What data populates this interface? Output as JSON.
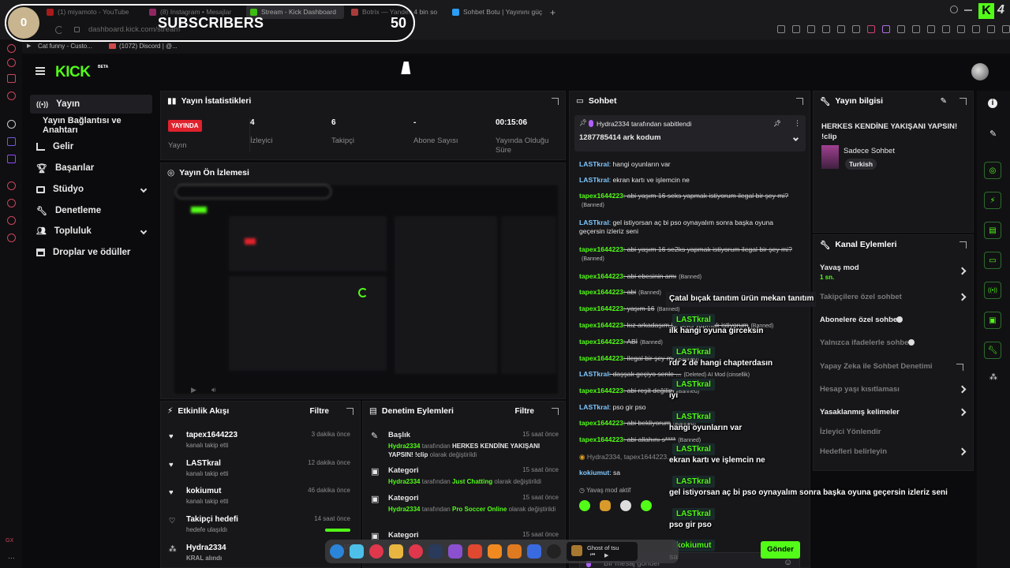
{
  "browser": {
    "tabs": [
      {
        "label": "(1) miyamoto - YouTube",
        "color": "#e02424"
      },
      {
        "label": "(8) Instagram • Mesajlar",
        "color": "#c13584"
      },
      {
        "label": "Stream - Kick Dashboard",
        "color": "#53fc18"
      },
      {
        "label": "Botrix — Yandex 4 bin so",
        "color": "#e05050"
      },
      {
        "label": "Sohbet Botu | Yayınını güç",
        "color": "#2a9df4"
      }
    ],
    "url": "dashboard.kick.com/stream",
    "bookmarks": [
      "Cat funny - Custo...",
      "(1072) Discord | @..."
    ],
    "brand_logo_text": "K",
    "brand_badge": "4"
  },
  "overlay": {
    "subscriber_count": "0",
    "subscribers_label": "SUBSCRIBERS",
    "subscribers_goal": "50"
  },
  "header": {
    "logo": "KICK",
    "beta": "BETA"
  },
  "sidebar": {
    "items": [
      {
        "label": "Yayın",
        "icon": "broadcast-icon"
      },
      {
        "label": "Yayın Bağlantısı ve Anahtarı",
        "icon": ""
      },
      {
        "label": "Gelir",
        "icon": "chart-icon"
      },
      {
        "label": "Başarılar",
        "icon": "trophy-icon"
      },
      {
        "label": "Stüdyo",
        "icon": "studio-icon"
      },
      {
        "label": "Denetleme",
        "icon": "wrench-icon"
      },
      {
        "label": "Topluluk",
        "icon": "users-icon"
      },
      {
        "label": "Droplar ve ödüller",
        "icon": "gift-icon"
      }
    ]
  },
  "stats": {
    "title": "Yayın İstatistikleri",
    "live_badge": "YAYINDA",
    "live_label": "Yayın",
    "viewers": {
      "value": "4",
      "label": "İzleyici"
    },
    "followers": {
      "value": "6",
      "label": "Takipçi"
    },
    "subs": {
      "value": "-",
      "label": "Abone Sayısı"
    },
    "uptime": {
      "value": "00:15:06",
      "label": "Yayında Olduğu Süre"
    }
  },
  "preview": {
    "title": "Yayın Ön İzlemesi"
  },
  "activity": {
    "title": "Etkinlik Akışı",
    "filter": "Filtre",
    "items": [
      {
        "name": "tapex1644223",
        "desc": "kanalı takip etti",
        "time": "3 dakika önce"
      },
      {
        "name": "LASTkral",
        "desc": "kanalı takip etti",
        "time": "12 dakika önce"
      },
      {
        "name": "kokiumut",
        "desc": "kanalı takip etti",
        "time": "46 dakika önce"
      },
      {
        "name": "Takipçi hedefi",
        "desc": "hedefe ulaşıldı",
        "time": "14 saat önce"
      },
      {
        "name": "Hydra2334",
        "desc": "KRAL alındı",
        "time": "15"
      }
    ]
  },
  "moderation": {
    "title": "Denetim Eylemleri",
    "filter": "Filtre",
    "items": [
      {
        "title": "Başlık",
        "user": "Hydra2334",
        "mid": "tarafından",
        "value": "HERKES KENDİNE YAKIŞANI YAPSIN! !clip",
        "end": "olarak değiştirildi",
        "time": "15 saat önce"
      },
      {
        "title": "Kategori",
        "user": "Hydra2334",
        "mid": "tarafından",
        "value": "Just Chatting",
        "end": "olarak değiştirildi",
        "time": "15 saat önce"
      },
      {
        "title": "Kategori",
        "user": "Hydra2334",
        "mid": "tarafından",
        "value": "Pro Soccer Online",
        "end": "olarak değiştirildi",
        "time": "15 saat önce"
      },
      {
        "title": "Kategori",
        "time": "15 saat önce"
      }
    ]
  },
  "chat": {
    "title": "Sohbet",
    "pinned_by": "Hydra2334 tarafından sabitlendi",
    "pinned_msg": "1287785414 ark kodum",
    "messages": [
      {
        "user": "LASTkral",
        "text": ": hangi oyunların var",
        "strike": false,
        "tag": "",
        "ucolor": "blue"
      },
      {
        "user": "LASTkral",
        "text": ": ekran kartı ve işlemcin ne",
        "strike": false,
        "tag": "",
        "ucolor": "blue"
      },
      {
        "user": "tapex1644223",
        "text": ": abi yaşım 16 seks yapmak istiyorum ilegal bir şey mi?",
        "strike": true,
        "tag": "(Banned)",
        "ucolor": "green"
      },
      {
        "user": "LASTkral",
        "text": ": gel istiyorsan aç bi pso oynayalım sonra başka oyuna geçersin izleriz seni",
        "strike": false,
        "tag": "",
        "ucolor": "blue"
      },
      {
        "user": "tapex1644223",
        "text": ": abi yaşım 16 se2ks yapmak istiyorum ilegal bir şey mi?",
        "strike": true,
        "tag": "(Banned)",
        "ucolor": "green"
      },
      {
        "user": "tapex1644223",
        "text": ": abi ebesinin amı",
        "strike": true,
        "tag": "(Banned)",
        "ucolor": "green"
      },
      {
        "user": "tapex1644223",
        "text": ": abi",
        "strike": true,
        "tag": "(Banned)",
        "ucolor": "green"
      },
      {
        "user": "tapex1644223",
        "text": ": yaşım 16",
        "strike": true,
        "tag": "(Banned)",
        "ucolor": "green"
      },
      {
        "user": "tapex1644223",
        "text": ": kız arkadaşım ile seks yapmak istiyorum",
        "strike": true,
        "tag": "(Banned)",
        "ucolor": "green"
      },
      {
        "user": "tapex1644223",
        "text": ": ABİ",
        "strike": true,
        "tag": "(Banned)",
        "ucolor": "green"
      },
      {
        "user": "tapex1644223",
        "text": ": ilegal bir şey mi",
        "strike": true,
        "tag": "(Banned)",
        "ucolor": "green"
      },
      {
        "user": "LASTkral",
        "text": ": daşşak geçiyo senle ...",
        "strike": true,
        "tag": "(Deleted) AI Mod (cinsellik)",
        "ucolor": "blue"
      },
      {
        "user": "tapex1644223",
        "text": ": abi reşit değilim",
        "strike": true,
        "tag": "(Banned)",
        "ucolor": "green"
      },
      {
        "user": "LASTkral",
        "text": ": pso gir pso",
        "strike": false,
        "tag": "",
        "ucolor": "blue"
      },
      {
        "user": "tapex1644223",
        "text": ": abi bekliyorum",
        "strike": true,
        "tag": "(Banned)",
        "ucolor": "green"
      },
      {
        "user": "tapex1644223",
        "text": ": abi allahını s****",
        "strike": true,
        "tag": "(Banned)",
        "ucolor": "green"
      }
    ],
    "system_line": "Hydra2334, tapex1644223...",
    "last_user": "kokiumut",
    "last_text": ": sa",
    "slow_mode": "Yavaş mod aktif",
    "input_placeholder": "Bir mesaj gönder",
    "send": "Gönder"
  },
  "stream_info": {
    "title": "Yayın bilgisi",
    "stream_title": "HERKES KENDİNE YAKIŞANI YAPSIN! !clip",
    "category": "Sadece Sohbet",
    "language": "Turkish"
  },
  "channel_actions": {
    "title": "Kanal Eylemleri",
    "slow_mode": "Yavaş mod",
    "slow_mode_value": "1 sn.",
    "items": [
      {
        "label": "Takipçilere özel sohbet",
        "kind": "chevron",
        "dim": true
      },
      {
        "label": "Abonelere özel sohbet",
        "kind": "toggle",
        "dim": false
      },
      {
        "label": "Yalnızca ifadelerle sohbet",
        "kind": "toggle",
        "dim": true
      },
      {
        "label": "Yapay Zeka ile Sohbet Denetimi",
        "kind": "ext",
        "dim": true
      },
      {
        "label": "Hesap yaşı kısıtlaması",
        "kind": "chevron",
        "dim": true
      },
      {
        "label": "Yasaklanmış kelimeler",
        "kind": "chevron",
        "dim": false
      },
      {
        "label": "İzleyici Yönlendir",
        "kind": "none",
        "dim": true
      },
      {
        "label": "Hedefleri belirleyin",
        "kind": "chevron",
        "dim": true
      }
    ]
  },
  "chat_overlay": [
    {
      "user": "",
      "text": "Çatal bıçak tanıtım ürün mekan tanıtım"
    },
    {
      "user": "LASTkral",
      "text": "ilk hangi oyuna girceksin"
    },
    {
      "user": "LASTkral",
      "text": "rdr 2 de hangi chapterdasın"
    },
    {
      "user": "LASTkral",
      "text": "iyi"
    },
    {
      "user": "LASTkral",
      "text": "hangi oyunların var"
    },
    {
      "user": "LASTkral",
      "text": "ekran kartı ve işlemcin ne"
    },
    {
      "user": "LASTkral",
      "text": "gel istiyorsan aç bi pso oynayalım sonra başka oyuna geçersin izleriz seni"
    },
    {
      "user": "LASTkral",
      "text": "pso gir pso"
    },
    {
      "user": "kokiumut",
      "text": "sa"
    }
  ],
  "dock": {
    "media_title": "Ghost of tsu"
  },
  "colors": {
    "accent": "#53fc18",
    "live": "#e0222c",
    "panel": "#17171a"
  }
}
